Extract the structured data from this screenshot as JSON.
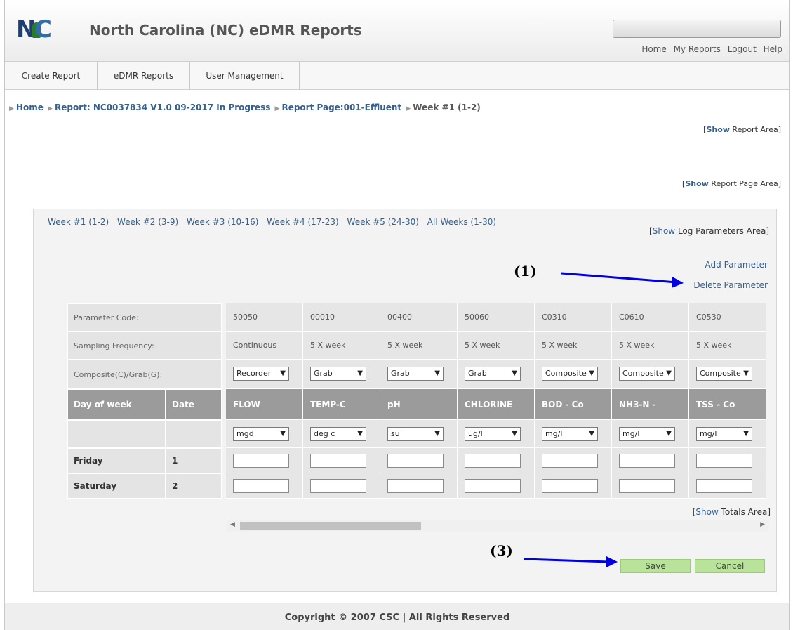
{
  "header": {
    "logo_text": "NC",
    "title": "North Carolina (NC) eDMR Reports",
    "links": [
      "Home",
      "My Reports",
      "Logout",
      "Help"
    ]
  },
  "nav": {
    "tabs": [
      "Create Report",
      "eDMR Reports",
      "User Management"
    ]
  },
  "breadcrumb": {
    "items": [
      "Home",
      "Report: NC0037834 V1.0 09-2017 In Progress",
      "Report Page:001-Effluent",
      "Week #1 (1-2)"
    ]
  },
  "toggles": {
    "show": "Show",
    "report_area": "Report Area",
    "report_page_area": "Report Page Area",
    "log_parameters_area": "Log Parameters Area",
    "totals_area": "Totals Area"
  },
  "week_tabs": [
    "Week #1 (1-2)",
    "Week #2 (3-9)",
    "Week #3 (10-16)",
    "Week #4 (17-23)",
    "Week #5 (24-30)",
    "All Weeks (1-30)"
  ],
  "param_actions": {
    "add": "Add Parameter",
    "delete": "Delete Parameter"
  },
  "annotations": {
    "a1": "(1)",
    "a3": "(3)"
  },
  "table": {
    "row_labels": {
      "parameter_code": "Parameter Code:",
      "sampling_frequency": "Sampling Frequency:",
      "composite_grab": "Composite(C)/Grab(G):"
    },
    "headers": {
      "day_of_week": "Day of week",
      "date": "Date"
    },
    "rows": [
      {
        "day": "Friday",
        "date": "1"
      },
      {
        "day": "Saturday",
        "date": "2"
      }
    ],
    "columns": [
      {
        "code": "50050",
        "frequency": "Continuous",
        "type": "Recorder",
        "name": "FLOW",
        "unit": "mgd"
      },
      {
        "code": "00010",
        "frequency": "5 X week",
        "type": "Grab",
        "name": "TEMP-C",
        "unit": "deg c"
      },
      {
        "code": "00400",
        "frequency": "5 X week",
        "type": "Grab",
        "name": "pH",
        "unit": "su"
      },
      {
        "code": "50060",
        "frequency": "5 X week",
        "type": "Grab",
        "name": "CHLORINE",
        "unit": "ug/l"
      },
      {
        "code": "C0310",
        "frequency": "5 X week",
        "type": "Composite",
        "name": "BOD - Co",
        "unit": "mg/l"
      },
      {
        "code": "C0610",
        "frequency": "5 X week",
        "type": "Composite",
        "name": "NH3-N -",
        "unit": "mg/l"
      },
      {
        "code": "C0530",
        "frequency": "5 X week",
        "type": "Composite",
        "name": "TSS - Co",
        "unit": "mg/l"
      }
    ]
  },
  "buttons": {
    "save": "Save",
    "cancel": "Cancel"
  },
  "footer": {
    "text": "Copyright © 2007 CSC | All Rights Reserved"
  },
  "colors": {
    "link": "#355f8c",
    "button": "#b9e39a",
    "header_dark": "#9b9b9b",
    "arrow": "#0000e0"
  }
}
